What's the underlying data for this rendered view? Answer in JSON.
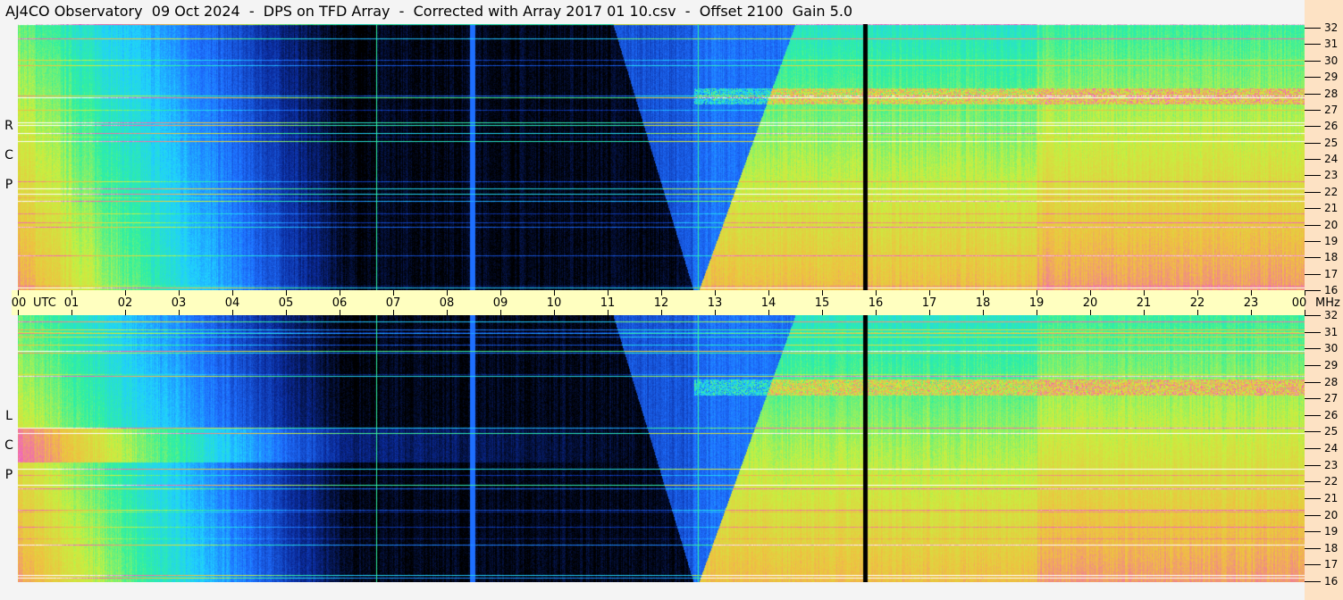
{
  "title": "AJ4CO Observatory  09 Oct 2024  -  DPS on TFD Array  -  Corrected with Array 2017 01 10.csv  -  Offset 2100  Gain 5.0",
  "chart_data": {
    "type": "heatmap",
    "title": "AJ4CO Observatory  09 Oct 2024  -  DPS on TFD Array  -  Corrected with Array 2017 01 10.csv  -  Offset 2100  Gain 5.0",
    "xlabel": "UTC",
    "ylabel": "MHz",
    "x_range": [
      0,
      24
    ],
    "y_range": [
      16,
      32
    ],
    "x_ticks": [
      "00",
      "01",
      "02",
      "03",
      "04",
      "05",
      "06",
      "07",
      "08",
      "09",
      "10",
      "11",
      "12",
      "13",
      "14",
      "15",
      "16",
      "17",
      "18",
      "19",
      "20",
      "21",
      "22",
      "23",
      "00"
    ],
    "y_ticks": [
      "32",
      "31",
      "30",
      "29",
      "28",
      "27",
      "26",
      "25",
      "24",
      "23",
      "22",
      "21",
      "20",
      "19",
      "18",
      "17",
      "16"
    ],
    "panels": [
      {
        "name": "RCP",
        "label": [
          "R",
          "C",
          "P"
        ]
      },
      {
        "name": "LCP",
        "label": [
          "L",
          "C",
          "P"
        ]
      }
    ],
    "colormap": [
      "#000000",
      "#0a2a9a",
      "#1e6fff",
      "#20d0ff",
      "#30f0a0",
      "#c8f040",
      "#f0c040",
      "#f060c0",
      "#ffffff"
    ],
    "night_dark_period_utc": [
      6.7,
      12.6
    ],
    "grid": false
  }
}
